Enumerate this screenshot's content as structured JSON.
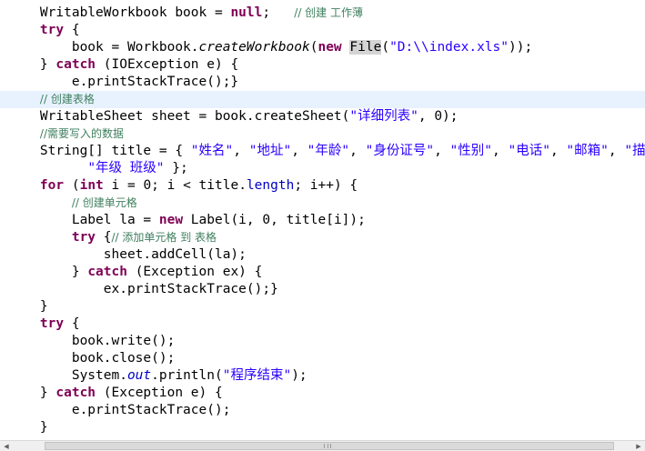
{
  "colors": {
    "keyword": "#7f0055",
    "string": "#2a00ff",
    "comment": "#3f7f5f",
    "field": "#0000c0",
    "current_line": "#e8f2fe",
    "occurrence": "#d4d4d4"
  },
  "scrollbar": {
    "left_arrow_icon": "scroll-left-arrow",
    "right_arrow_icon": "scroll-right-arrow"
  },
  "lines": [
    {
      "tokens": [
        {
          "t": "    WritableWorkbook book = "
        },
        {
          "t": "null",
          "s": "kw"
        },
        {
          "t": ";   "
        },
        {
          "t": "// 创建 工作薄",
          "s": "cm"
        }
      ]
    },
    {
      "tokens": [
        {
          "t": "    "
        },
        {
          "t": "try",
          "s": "kw"
        },
        {
          "t": " {"
        }
      ]
    },
    {
      "tokens": [
        {
          "t": "        book = Workbook."
        },
        {
          "t": "createWorkbook",
          "s": "it"
        },
        {
          "t": "("
        },
        {
          "t": "new",
          "s": "kw"
        },
        {
          "t": " "
        },
        {
          "t": "File",
          "s": "occ"
        },
        {
          "t": "("
        },
        {
          "t": "\"D:\\\\index.xls\"",
          "s": "str"
        },
        {
          "t": "));"
        }
      ]
    },
    {
      "tokens": [
        {
          "t": "    } "
        },
        {
          "t": "catch",
          "s": "kw"
        },
        {
          "t": " (IOException e) {"
        }
      ]
    },
    {
      "tokens": [
        {
          "t": "        e.printStackTrace();}"
        }
      ]
    },
    {
      "current": true,
      "tokens": [
        {
          "t": "    "
        },
        {
          "t": "// 创建表格",
          "s": "cm"
        }
      ]
    },
    {
      "tokens": [
        {
          "t": "    WritableSheet sheet = book.createSheet("
        },
        {
          "t": "\"详细列表\"",
          "s": "str"
        },
        {
          "t": ", 0);"
        }
      ]
    },
    {
      "tokens": [
        {
          "t": "    "
        },
        {
          "t": "//需要写入的数据",
          "s": "cm"
        }
      ]
    },
    {
      "tokens": [
        {
          "t": "    String[] title = { "
        },
        {
          "t": "\"姓名\"",
          "s": "str"
        },
        {
          "t": ", "
        },
        {
          "t": "\"地址\"",
          "s": "str"
        },
        {
          "t": ", "
        },
        {
          "t": "\"年龄\"",
          "s": "str"
        },
        {
          "t": ", "
        },
        {
          "t": "\"身份证号\"",
          "s": "str"
        },
        {
          "t": ", "
        },
        {
          "t": "\"性别\"",
          "s": "str"
        },
        {
          "t": ", "
        },
        {
          "t": "\"电话\"",
          "s": "str"
        },
        {
          "t": ", "
        },
        {
          "t": "\"邮箱\"",
          "s": "str"
        },
        {
          "t": ", "
        },
        {
          "t": "\"描述\"",
          "s": "str"
        }
      ]
    },
    {
      "tokens": [
        {
          "t": "          "
        },
        {
          "t": "\"年级 班级\"",
          "s": "str"
        },
        {
          "t": " };"
        }
      ]
    },
    {
      "tokens": [
        {
          "t": "    "
        },
        {
          "t": "for",
          "s": "kw"
        },
        {
          "t": " ("
        },
        {
          "t": "int",
          "s": "kw"
        },
        {
          "t": " i = 0; i < title."
        },
        {
          "t": "length",
          "s": "fld"
        },
        {
          "t": "; i++) {"
        }
      ]
    },
    {
      "tokens": [
        {
          "t": "        "
        },
        {
          "t": "// 创建单元格",
          "s": "cm"
        }
      ]
    },
    {
      "tokens": [
        {
          "t": "        Label la = "
        },
        {
          "t": "new",
          "s": "kw"
        },
        {
          "t": " Label(i, 0, title[i]);"
        }
      ]
    },
    {
      "tokens": [
        {
          "t": "        "
        },
        {
          "t": "try",
          "s": "kw"
        },
        {
          "t": " {"
        },
        {
          "t": "// 添加单元格 到 表格",
          "s": "cm"
        }
      ]
    },
    {
      "tokens": [
        {
          "t": "            sheet.addCell(la);"
        }
      ]
    },
    {
      "tokens": [
        {
          "t": "        } "
        },
        {
          "t": "catch",
          "s": "kw"
        },
        {
          "t": " (Exception ex) {"
        }
      ]
    },
    {
      "tokens": [
        {
          "t": "            ex.printStackTrace();}"
        }
      ]
    },
    {
      "tokens": [
        {
          "t": "    }"
        }
      ]
    },
    {
      "tokens": [
        {
          "t": "    "
        },
        {
          "t": "try",
          "s": "kw"
        },
        {
          "t": " {"
        }
      ]
    },
    {
      "tokens": [
        {
          "t": "        book.write();"
        }
      ]
    },
    {
      "tokens": [
        {
          "t": "        book.close();"
        }
      ]
    },
    {
      "tokens": [
        {
          "t": "        System."
        },
        {
          "t": "out",
          "s": "sfld"
        },
        {
          "t": ".println("
        },
        {
          "t": "\"程序结束\"",
          "s": "str"
        },
        {
          "t": ");"
        }
      ]
    },
    {
      "tokens": [
        {
          "t": "    } "
        },
        {
          "t": "catch",
          "s": "kw"
        },
        {
          "t": " (Exception e) {"
        }
      ]
    },
    {
      "tokens": [
        {
          "t": "        e.printStackTrace();"
        }
      ]
    },
    {
      "tokens": [
        {
          "t": "    }"
        }
      ]
    }
  ]
}
